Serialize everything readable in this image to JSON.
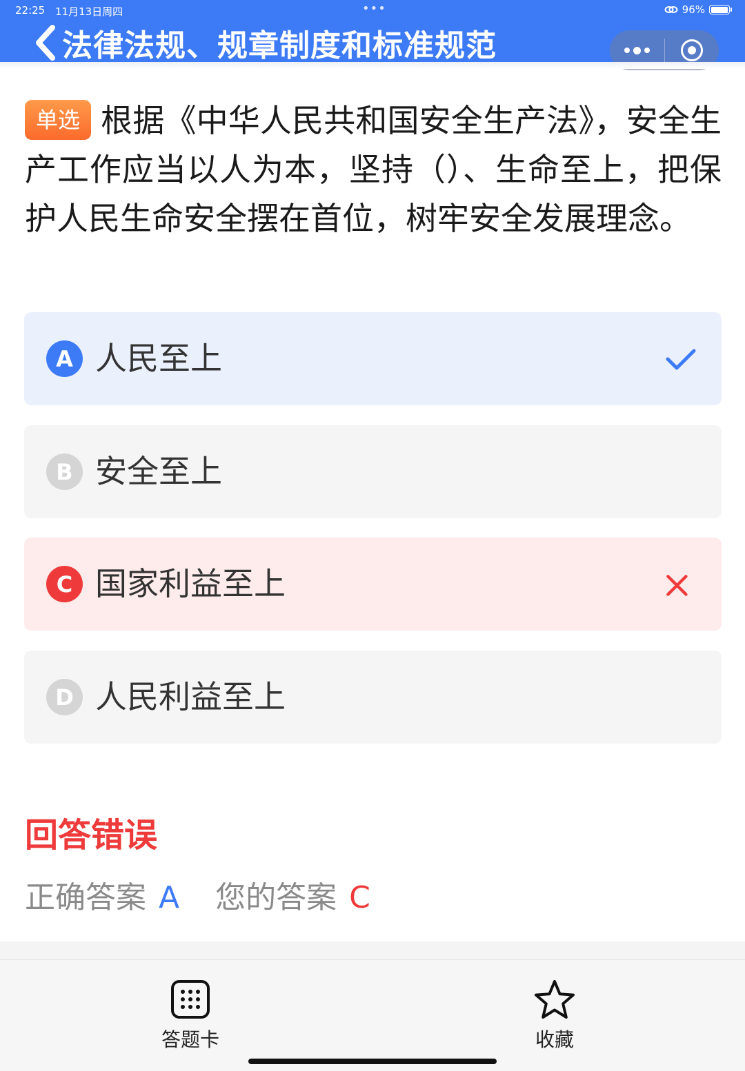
{
  "status_bar": {
    "time": "22:25",
    "date": "11月13日周四",
    "battery_text": "96%",
    "battery_level": 0.96
  },
  "nav": {
    "title": "法律法规、规章制度和标准规范"
  },
  "question": {
    "type_badge": "单选",
    "text": "根据《中华人民共和国安全生产法》，安全生产工作应当以人为本，坚持（）、生命至上，把保护人民生命安全摆在首位，树牢安全发展理念。"
  },
  "options": [
    {
      "letter": "A",
      "text": "人民至上",
      "state": "correct"
    },
    {
      "letter": "B",
      "text": "安全至上",
      "state": "normal"
    },
    {
      "letter": "C",
      "text": "国家利益至上",
      "state": "wrong"
    },
    {
      "letter": "D",
      "text": "人民利益至上",
      "state": "normal"
    }
  ],
  "result": {
    "title": "回答错误",
    "correct_label": "正确答案",
    "correct_value": "A",
    "mine_label": "您的答案",
    "mine_value": "C"
  },
  "toolbar": {
    "answer_card_label": "答题卡",
    "favorite_label": "收藏"
  },
  "colors": {
    "brand_blue": "#3d7af5",
    "error_red": "#ee3a3a",
    "badge_orange": "#fb6a2c"
  }
}
